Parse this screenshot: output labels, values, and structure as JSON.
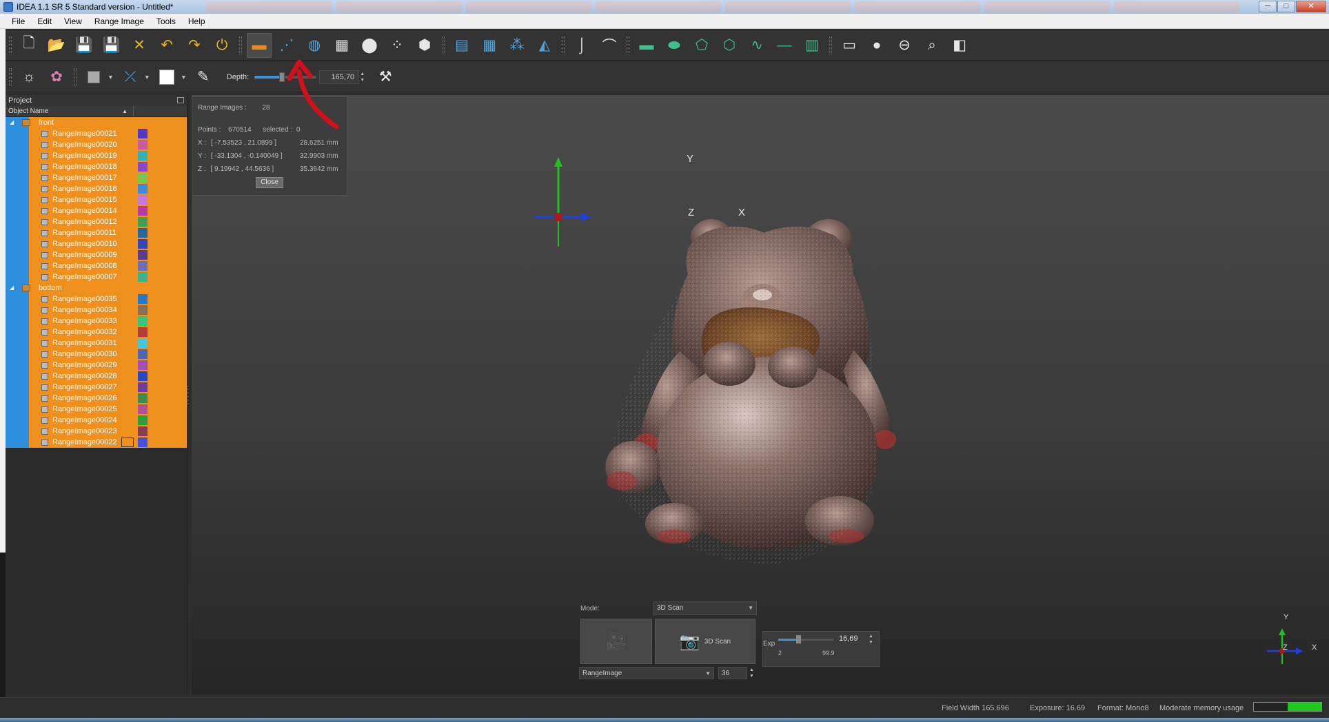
{
  "window": {
    "title": "IDEA 1.1 SR 5 Standard version - Untitled*",
    "buttons": {
      "minimize": "─",
      "maximize": "□",
      "close": "✕"
    }
  },
  "menu": [
    "File",
    "Edit",
    "View",
    "Range Image",
    "Tools",
    "Help"
  ],
  "toolbar1": {
    "buttons": [
      {
        "icon": "new-file-icon",
        "glyph": "🗋",
        "color": "white"
      },
      {
        "icon": "open-folder-icon",
        "glyph": "📂",
        "color": "yellow"
      },
      {
        "icon": "save-icon",
        "glyph": "💾",
        "color": "yellow"
      },
      {
        "icon": "save-as-icon",
        "glyph": "💾",
        "color": "yellow"
      },
      {
        "icon": "close-project-icon",
        "glyph": "✕",
        "color": "yellow"
      },
      {
        "icon": "undo-icon",
        "glyph": "↶",
        "color": "yellow"
      },
      {
        "icon": "redo-icon",
        "glyph": "↷",
        "color": "yellow"
      },
      {
        "icon": "power-icon",
        "glyph": "⏻",
        "color": "yellow"
      },
      {
        "icon": "scanner-icon",
        "glyph": "▬",
        "color": "orange"
      },
      {
        "icon": "point-cloud-icon",
        "glyph": "⋰",
        "color": "blue"
      },
      {
        "icon": "rotate-globe-icon",
        "glyph": "◍",
        "color": "blue"
      },
      {
        "icon": "mesh-grid-icon",
        "glyph": "▦",
        "color": "white"
      },
      {
        "icon": "merge-spheres-icon",
        "glyph": "⬤",
        "color": "white"
      },
      {
        "icon": "align-points-icon",
        "glyph": "⁘",
        "color": "white"
      },
      {
        "icon": "hexagon-icon",
        "glyph": "⬢",
        "color": "white"
      },
      {
        "icon": "layers-icon",
        "glyph": "▤",
        "color": "blue"
      },
      {
        "icon": "grid-select-icon",
        "glyph": "▦",
        "color": "blue"
      },
      {
        "icon": "scatter-icon",
        "glyph": "⁂",
        "color": "blue"
      },
      {
        "icon": "plane-icon",
        "glyph": "◭",
        "color": "blue"
      },
      {
        "icon": "hook-icon",
        "glyph": "⌡",
        "color": "white"
      },
      {
        "icon": "curve-icon",
        "glyph": "⌒",
        "color": "white"
      },
      {
        "icon": "rectangle-icon",
        "glyph": "▬",
        "color": "green"
      },
      {
        "icon": "ellipse-icon",
        "glyph": "⬬",
        "color": "green"
      },
      {
        "icon": "polygon-icon",
        "glyph": "⬠",
        "color": "green"
      },
      {
        "icon": "freeform-icon",
        "glyph": "⬡",
        "color": "green"
      },
      {
        "icon": "spline-icon",
        "glyph": "∿",
        "color": "green"
      },
      {
        "icon": "line-icon",
        "glyph": "—",
        "color": "green"
      },
      {
        "icon": "stack-panel-icon",
        "glyph": "▥",
        "color": "green"
      },
      {
        "icon": "window-icon",
        "glyph": "▭",
        "color": "white"
      },
      {
        "icon": "dot-icon",
        "glyph": "●",
        "color": "white"
      },
      {
        "icon": "turntable-icon",
        "glyph": "⊖",
        "color": "white"
      },
      {
        "icon": "zoom-icon",
        "glyph": "⌕",
        "color": "white"
      },
      {
        "icon": "view-cube-icon",
        "glyph": "◧",
        "color": "white"
      }
    ]
  },
  "toolbar2": {
    "depth_label": "Depth:",
    "depth_value": "165,70",
    "depth_level": 0.44
  },
  "project_panel": {
    "title": "Project",
    "column": "Object Name",
    "groups": [
      {
        "name": "front",
        "items": [
          {
            "label": "RangeImage00021",
            "color": "#5038c8"
          },
          {
            "label": "RangeImage00020",
            "color": "#c85aa0"
          },
          {
            "label": "RangeImage00019",
            "color": "#32b4b4"
          },
          {
            "label": "RangeImage00018",
            "color": "#8c46c8"
          },
          {
            "label": "RangeImage00017",
            "color": "#78c850"
          },
          {
            "label": "RangeImage00016",
            "color": "#3c8cdc"
          },
          {
            "label": "RangeImage00015",
            "color": "#c878dc"
          },
          {
            "label": "RangeImage00014",
            "color": "#b43ca0"
          },
          {
            "label": "RangeImage00012",
            "color": "#3ca050"
          },
          {
            "label": "RangeImage00011",
            "color": "#2864a0"
          },
          {
            "label": "RangeImage00010",
            "color": "#3246b4"
          },
          {
            "label": "RangeImage00009",
            "color": "#5a3c8c"
          },
          {
            "label": "RangeImage00008",
            "color": "#6e6eb4"
          },
          {
            "label": "RangeImage00007",
            "color": "#3cb48c"
          }
        ]
      },
      {
        "name": "bottom",
        "items": [
          {
            "label": "RangeImage00035",
            "color": "#2878c8"
          },
          {
            "label": "RangeImage00034",
            "color": "#8c6e50"
          },
          {
            "label": "RangeImage00033",
            "color": "#32c878"
          },
          {
            "label": "RangeImage00032",
            "color": "#b43c3c"
          },
          {
            "label": "RangeImage00031",
            "color": "#46c8dc"
          },
          {
            "label": "RangeImage00030",
            "color": "#5064b4"
          },
          {
            "label": "RangeImage00029",
            "color": "#a050b4"
          },
          {
            "label": "RangeImage00028",
            "color": "#2846c8"
          },
          {
            "label": "RangeImage00027",
            "color": "#6e3ca0"
          },
          {
            "label": "RangeImage00026",
            "color": "#3c8c50"
          },
          {
            "label": "RangeImage00025",
            "color": "#b45096"
          },
          {
            "label": "RangeImage00024",
            "color": "#28a03c"
          },
          {
            "label": "RangeImage00023",
            "color": "#8c3c50"
          },
          {
            "label": "RangeImage00022",
            "color": "#4650dc"
          }
        ]
      }
    ]
  },
  "info_panel": {
    "range_images_label": "Range Images :",
    "range_images_value": "28",
    "points_label": "Points :",
    "points_value": "670514",
    "selected_label": "selected :",
    "selected_value": "0",
    "x_label": "X :",
    "x_range": "[ -7.53523 , 21.0899 ]",
    "x_size": "28.6251 mm",
    "y_label": "Y :",
    "y_range": "[ -33.1304 , -0.140049 ]",
    "y_size": "32.9903 mm",
    "z_label": "Z :",
    "z_range": "[ 9.19942 , 44.5636 ]",
    "z_size": "35.3642 mm",
    "close_label": "Close"
  },
  "viewport": {
    "axis_x": "X",
    "axis_y": "Y",
    "axis_z": "Z",
    "mini_x": "X",
    "mini_y": "Y",
    "mini_z": "Z"
  },
  "scan_panel": {
    "mode_label": "Mode:",
    "mode_value": "3D Scan",
    "video_icon": "video-camera-icon",
    "scan_button": "3D Scan",
    "exp_label": "Exp",
    "exp_value": "16,69",
    "exp_level": 0.17,
    "exp_min": "2",
    "exp_max": "99.9",
    "type_value": "RangeImage",
    "count_value": "36"
  },
  "status": {
    "field_width": "Field Width 165.696",
    "exposure": "Exposure: 16.69",
    "format": "Format: Mono8",
    "memory": "Moderate memory usage",
    "memory_level": 0.5
  },
  "colors": {
    "accent": "#f0901c",
    "selection_blue": "#2e8fde",
    "annotation_red": "#d0101a"
  }
}
